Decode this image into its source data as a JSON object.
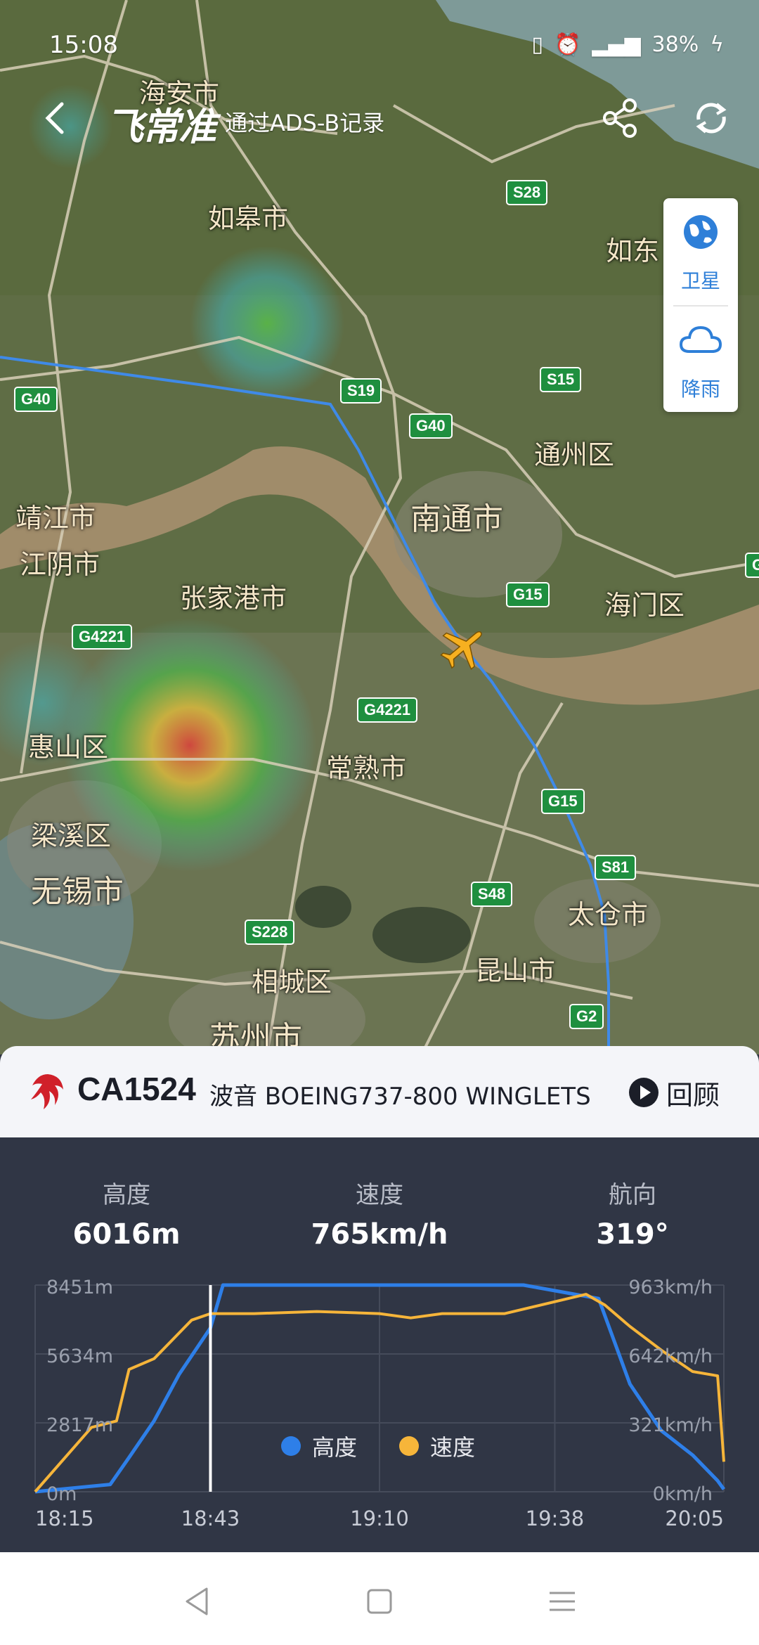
{
  "status_bar": {
    "time": "15:08",
    "battery": "38%"
  },
  "header": {
    "logo": "飞常准",
    "subtitle": "通过ADS-B记录"
  },
  "layers": [
    {
      "label": "卫星",
      "icon": "globe-icon"
    },
    {
      "label": "降雨",
      "icon": "cloud-icon"
    }
  ],
  "map": {
    "cities": [
      "海安市",
      "如皋市",
      "如东",
      "通州区",
      "南通市",
      "靖江市",
      "江阴市",
      "张家港市",
      "海门区",
      "惠山区",
      "常熟市",
      "梁溪区",
      "无锡市",
      "太仓市",
      "昆山市",
      "相城区",
      "苏州市"
    ],
    "roads": [
      "S28",
      "G40",
      "S19",
      "G40",
      "S15",
      "G15",
      "G4221",
      "G4221",
      "G15",
      "S81",
      "S48",
      "S228",
      "G2",
      "G"
    ]
  },
  "flight": {
    "number": "CA1524",
    "aircraft": "波音 BOEING737-800 WINGLETS",
    "replay_label": "回顾"
  },
  "stats": [
    {
      "title": "高度",
      "value": "6016m"
    },
    {
      "title": "速度",
      "value": "765km/h"
    },
    {
      "title": "航向",
      "value": "319°"
    }
  ],
  "chart_data": {
    "type": "line",
    "x_ticks": [
      "18:15",
      "18:43",
      "19:10",
      "19:38",
      "20:05"
    ],
    "y_left_ticks": [
      "8451m",
      "5634m",
      "2817m",
      "0m"
    ],
    "y_right_ticks": [
      "963km/h",
      "642km/h",
      "321km/h",
      "0km/h"
    ],
    "series": [
      {
        "name": "高度",
        "color": "#2e7fe8",
        "unit": "m",
        "x": [
          "18:15",
          "18:27",
          "18:30",
          "18:34",
          "18:38",
          "18:43",
          "18:45",
          "19:10",
          "19:33",
          "19:45",
          "19:50",
          "19:55",
          "20:00",
          "20:04",
          "20:05"
        ],
        "values": [
          0,
          300,
          1400,
          2900,
          4800,
          6700,
          8451,
          8451,
          8451,
          7900,
          4400,
          2500,
          1500,
          450,
          100
        ]
      },
      {
        "name": "速度",
        "color": "#f6b53a",
        "unit": "km/h",
        "x": [
          "18:15",
          "18:24",
          "18:28",
          "18:30",
          "18:34",
          "18:40",
          "18:43",
          "18:50",
          "19:00",
          "19:10",
          "19:15",
          "19:20",
          "19:30",
          "19:43",
          "19:46",
          "19:50",
          "19:55",
          "20:00",
          "20:04",
          "20:05"
        ],
        "values": [
          0,
          300,
          330,
          570,
          620,
          800,
          830,
          830,
          840,
          830,
          810,
          830,
          830,
          920,
          870,
          770,
          660,
          560,
          540,
          140
        ]
      }
    ],
    "cursor_x": "18:43"
  }
}
